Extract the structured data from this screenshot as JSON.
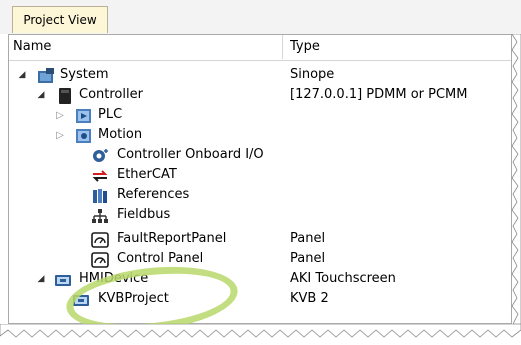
{
  "tab": {
    "label": "Project View"
  },
  "columns": {
    "name": "Name",
    "type": "Type"
  },
  "rows": [
    {
      "name": "System",
      "type": "Sinope",
      "icon": "system-icon",
      "expander": "expanded"
    },
    {
      "name": "Controller",
      "type": "[127.0.0.1] PDMM or PCMM",
      "icon": "controller-icon",
      "expander": "expanded"
    },
    {
      "name": "PLC",
      "type": "",
      "icon": "plc-icon",
      "expander": "collapsed"
    },
    {
      "name": "Motion",
      "type": "",
      "icon": "motion-icon",
      "expander": "collapsed"
    },
    {
      "name": "Controller Onboard I/O",
      "type": "",
      "icon": "io-icon",
      "expander": "none"
    },
    {
      "name": "EtherCAT",
      "type": "",
      "icon": "ethercat-icon",
      "expander": "none"
    },
    {
      "name": "References",
      "type": "",
      "icon": "references-icon",
      "expander": "none"
    },
    {
      "name": "Fieldbus",
      "type": "",
      "icon": "fieldbus-icon",
      "expander": "none"
    },
    {
      "name": "FaultReportPanel",
      "type": "Panel",
      "icon": "panel-icon",
      "expander": "none"
    },
    {
      "name": "Control Panel",
      "type": "Panel",
      "icon": "panel-icon",
      "expander": "none"
    },
    {
      "name": "HMIDevice",
      "type": "AKI Touchscreen",
      "icon": "hmi-device-icon",
      "expander": "expanded"
    },
    {
      "name": "KVBProject",
      "type": "KVB 2",
      "icon": "kvb-project-icon",
      "expander": "none"
    }
  ],
  "colors": {
    "highlight_circle": "#b8d86a",
    "tab_background": "#fdf7d8"
  }
}
